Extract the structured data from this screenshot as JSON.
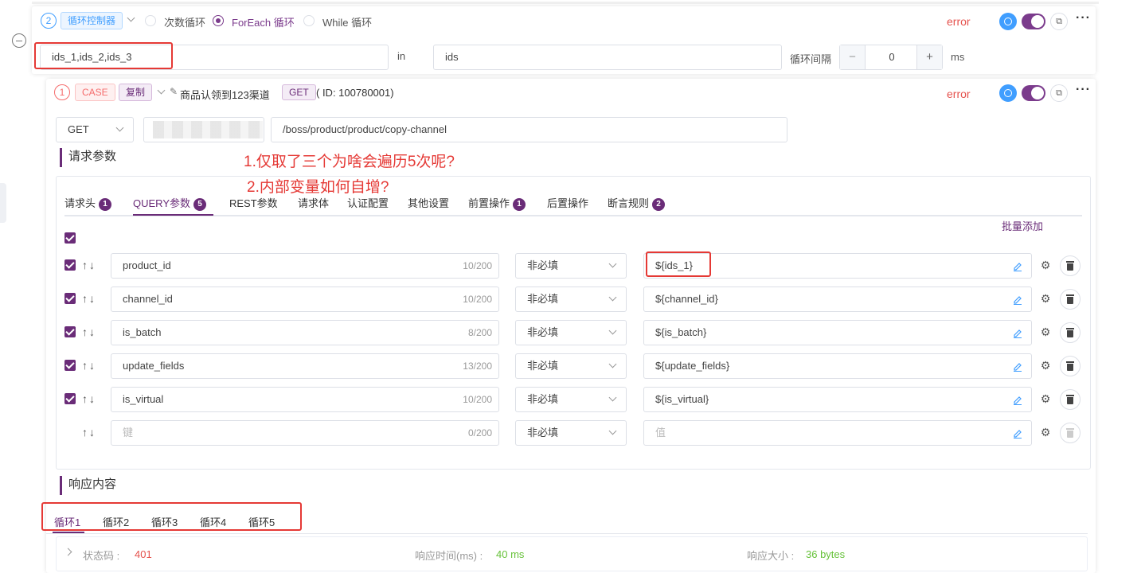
{
  "loop": {
    "index": "2",
    "tag": "循环控制器",
    "radios": [
      {
        "label": "次数循环",
        "selected": false
      },
      {
        "label": "ForEach 循环",
        "selected": true
      },
      {
        "label": "While 循环",
        "selected": false
      }
    ],
    "status": "error",
    "variables_value": "ids_1,ids_2,ids_3",
    "in_label": "in",
    "iter_var": "ids",
    "interval_label": "循环间隔",
    "interval_minus": "−",
    "interval_value": "0",
    "interval_plus": "+",
    "interval_unit": "ms"
  },
  "case": {
    "index": "1",
    "tag": "CASE",
    "copy_tag": "复制",
    "name": "商品认领到123渠道",
    "method_tag": "GET",
    "id_text": "( ID: 100780001)",
    "status": "error",
    "method_select": "GET",
    "path": "/boss/product/product/copy-channel"
  },
  "request_section": "请求参数",
  "tabs": [
    {
      "label": "请求头",
      "badge": "1"
    },
    {
      "label": "QUERY参数",
      "badge": "5",
      "active": true
    },
    {
      "label": "REST参数",
      "badge": ""
    },
    {
      "label": "请求体",
      "badge": ""
    },
    {
      "label": "认证配置",
      "badge": ""
    },
    {
      "label": "其他设置",
      "badge": ""
    },
    {
      "label": "前置操作",
      "badge": "1"
    },
    {
      "label": "后置操作",
      "badge": ""
    },
    {
      "label": "断言规则",
      "badge": "2"
    }
  ],
  "bulk_add": "批量添加",
  "params": [
    {
      "checked": true,
      "key": "product_id",
      "count": "10/200",
      "required": "非必填",
      "value": "${ids_1}",
      "placeholder": false
    },
    {
      "checked": true,
      "key": "channel_id",
      "count": "10/200",
      "required": "非必填",
      "value": "${channel_id}",
      "placeholder": false
    },
    {
      "checked": true,
      "key": "is_batch",
      "count": "8/200",
      "required": "非必填",
      "value": "${is_batch}",
      "placeholder": false
    },
    {
      "checked": true,
      "key": "update_fields",
      "count": "13/200",
      "required": "非必填",
      "value": "${update_fields}",
      "placeholder": false
    },
    {
      "checked": true,
      "key": "is_virtual",
      "count": "10/200",
      "required": "非必填",
      "value": "${is_virtual}",
      "placeholder": false
    },
    {
      "checked": false,
      "key": "键",
      "count": "0/200",
      "required": "非必填",
      "value": "值",
      "placeholder": true
    }
  ],
  "annotations": [
    "1.仅取了三个为啥会遍历5次呢?",
    "2.内部变量如何自增?"
  ],
  "response_section": "响应内容",
  "response_tabs": [
    "循环1",
    "循环2",
    "循环3",
    "循环4",
    "循环5"
  ],
  "response": {
    "status_label": "状态码 :",
    "status_value": "401",
    "time_label": "响应时间(ms) :",
    "time_value": "40 ms",
    "size_label": "响应大小 :",
    "size_value": "36 bytes"
  },
  "colors": {
    "primary": "#6a2c78",
    "error": "#e5524d",
    "success": "#67c23a",
    "annotation": "#e53935",
    "link": "#409eff"
  }
}
